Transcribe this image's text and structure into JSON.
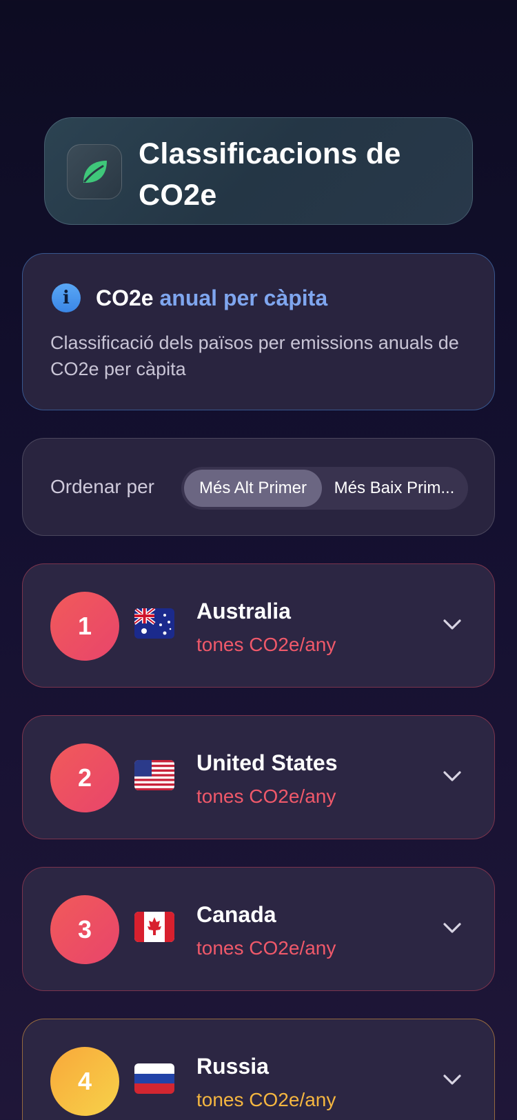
{
  "header": {
    "title": "Classificacions de CO2e",
    "icon": "leaf-icon"
  },
  "info": {
    "title_part1": "CO2e",
    "title_part2": "anual per càpita",
    "description": "Classificació dels països per emissions anuals de CO2e per càpita",
    "icon": "info-icon"
  },
  "sort": {
    "label": "Ordenar per",
    "options": [
      "Més Alt Primer",
      "Més Baix Prim..."
    ],
    "selected": "Més Alt Primer"
  },
  "rankings": [
    {
      "rank": "1",
      "country": "Australia",
      "unit": "tones CO2e/any"
    },
    {
      "rank": "2",
      "country": "United States",
      "unit": "tones CO2e/any"
    },
    {
      "rank": "3",
      "country": "Canada",
      "unit": "tones CO2e/any"
    },
    {
      "rank": "4",
      "country": "Russia",
      "unit": "tones CO2e/any"
    }
  ],
  "colors": {
    "accent_red": "#f0596a",
    "accent_gold": "#f5b640",
    "info_blue": "#7fa6ef",
    "leaf_green": "#3fc77a"
  }
}
